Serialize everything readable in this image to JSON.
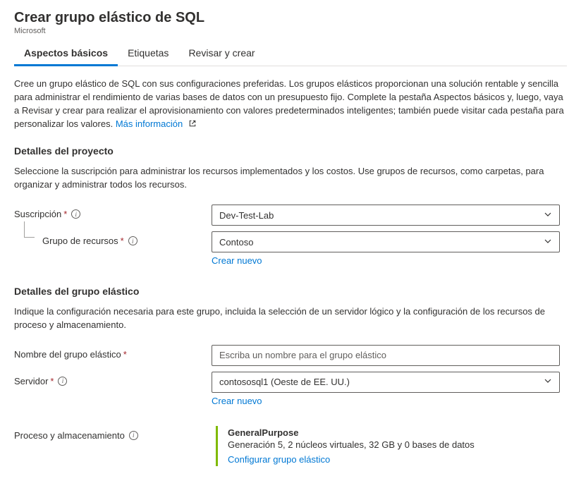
{
  "header": {
    "title": "Crear grupo elástico de SQL",
    "vendor": "Microsoft"
  },
  "tabs": {
    "basics": "Aspectos básicos",
    "tags": "Etiquetas",
    "review": "Revisar y crear"
  },
  "intro": {
    "text": "Cree un grupo elástico de SQL con sus configuraciones preferidas. Los grupos elásticos proporcionan una solución rentable y sencilla para administrar el rendimiento de varias bases de datos con un presupuesto fijo. Complete la pestaña Aspectos básicos y, luego, vaya a Revisar y crear para realizar el aprovisionamiento con valores predeterminados inteligentes; también puede visitar cada pestaña para personalizar los valores.",
    "more_info": "Más información"
  },
  "project": {
    "title": "Detalles del proyecto",
    "desc": "Seleccione la suscripción para administrar los recursos implementados y los costos. Use grupos de recursos, como carpetas, para organizar y administrar todos los recursos.",
    "subscription_label": "Suscripción",
    "subscription_value": "Dev-Test-Lab",
    "rg_label": "Grupo de recursos",
    "rg_value": "Contoso",
    "create_new": "Crear nuevo"
  },
  "pool": {
    "title": "Detalles del grupo elástico",
    "desc": "Indique la configuración necesaria para este grupo, incluida la selección de un servidor lógico y la configuración de los recursos de proceso y almacenamiento.",
    "name_label": "Nombre del grupo elástico",
    "name_placeholder": "Escriba un nombre para el grupo elástico",
    "server_label": "Servidor",
    "server_value": "contososql1 (Oeste de EE. UU.)",
    "create_new": "Crear nuevo"
  },
  "compute": {
    "label": "Proceso y almacenamiento",
    "tier": "GeneralPurpose",
    "detail": "Generación 5, 2 núcleos virtuales, 32 GB y 0 bases de datos",
    "configure": "Configurar grupo elástico"
  }
}
